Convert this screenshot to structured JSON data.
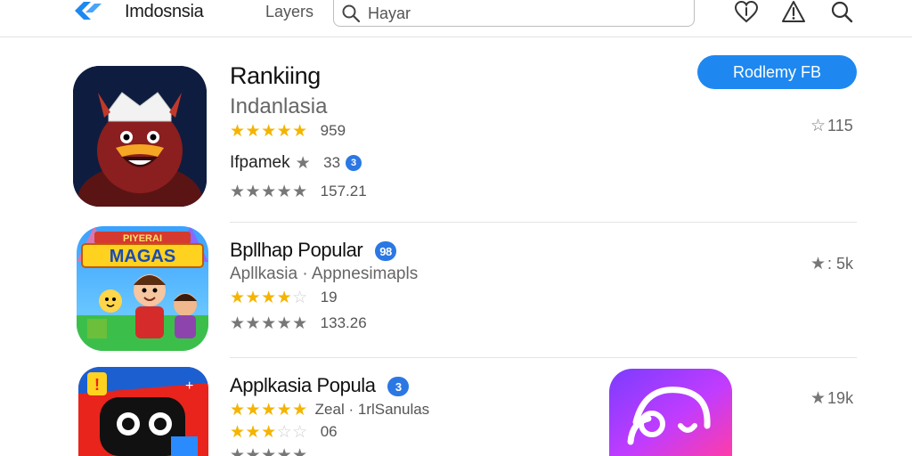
{
  "topbar": {
    "brand": "Imdosnsia",
    "layers_label": "Layers",
    "search_placeholder": "Hayar",
    "icons": [
      "logo-icon",
      "heart-icon",
      "alert-icon",
      "search-icon"
    ]
  },
  "header_cta": "Rodlemy FB",
  "rows": [
    {
      "title": "Rankiing",
      "subtitle": "Indanlasia",
      "line1_value": "959",
      "line2_label": "Ifpamek",
      "line2_value": "33",
      "line2_badge": "3",
      "line3_value": "157.21",
      "right_value": "115"
    },
    {
      "title": "Bpllhap Popular",
      "title_badge": "98",
      "subtitle": "Apllkasia · Appnesimapls",
      "line1_value": "19",
      "line2_value": "133.26",
      "right_value": ": 5k",
      "icon_banner": "MAGAS",
      "icon_banner_top": "PIYERAI"
    },
    {
      "title": "Applkasia Popula",
      "title_badge": "3",
      "line1_value": "Zeal · 1rlSanulas",
      "line2_value": "06",
      "right_value": "19k"
    }
  ],
  "colors": {
    "accent": "#1e88f0",
    "star_yellow": "#f4b400",
    "badge_blue": "#2b78e4"
  }
}
